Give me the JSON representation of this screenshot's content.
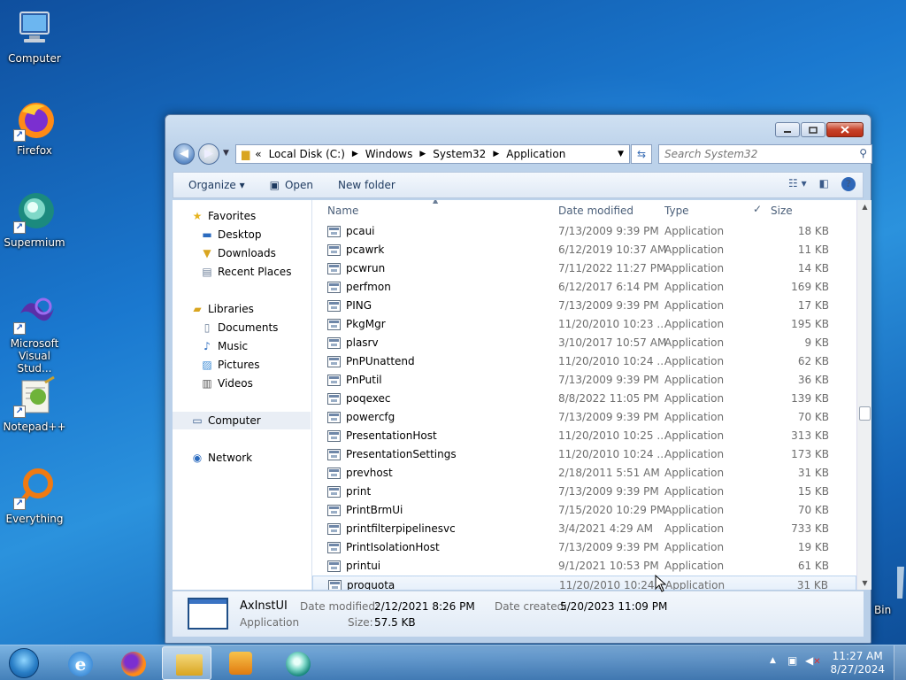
{
  "desktop": {
    "icons": [
      {
        "label": "Computer",
        "icon": "computer-icon"
      },
      {
        "label": "Firefox",
        "icon": "firefox-icon"
      },
      {
        "label": "Supermium",
        "icon": "supermium-icon"
      },
      {
        "label": "Microsoft Visual Stud...",
        "icon": "visual-studio-icon"
      },
      {
        "label": "Notepad++",
        "icon": "notepadpp-icon"
      },
      {
        "label": "Everything",
        "icon": "everything-icon"
      }
    ],
    "recycle_bin_label": "Bin"
  },
  "window": {
    "address": {
      "prefix": "«",
      "segments": [
        "Local Disk (C:)",
        "Windows",
        "System32",
        "Application"
      ]
    },
    "search_placeholder": "Search System32",
    "toolbar": {
      "organize": "Organize ▾",
      "open": "Open",
      "new_folder": "New folder"
    },
    "sidebar": {
      "favorites": "Favorites",
      "desktop": "Desktop",
      "downloads": "Downloads",
      "recent_places": "Recent Places",
      "libraries": "Libraries",
      "documents": "Documents",
      "music": "Music",
      "pictures": "Pictures",
      "videos": "Videos",
      "computer": "Computer",
      "network": "Network"
    },
    "columns": {
      "name": "Name",
      "date_modified": "Date modified",
      "type": "Type",
      "size": "Size"
    },
    "files": [
      {
        "name": "pcaui",
        "date": "7/13/2009 9:39 PM",
        "type": "Application",
        "size": "18 KB"
      },
      {
        "name": "pcawrk",
        "date": "6/12/2019 10:37 AM",
        "type": "Application",
        "size": "11 KB"
      },
      {
        "name": "pcwrun",
        "date": "7/11/2022 11:27 PM",
        "type": "Application",
        "size": "14 KB"
      },
      {
        "name": "perfmon",
        "date": "6/12/2017 6:14 PM",
        "type": "Application",
        "size": "169 KB"
      },
      {
        "name": "PING",
        "date": "7/13/2009 9:39 PM",
        "type": "Application",
        "size": "17 KB"
      },
      {
        "name": "PkgMgr",
        "date": "11/20/2010 10:23 ...",
        "type": "Application",
        "size": "195 KB"
      },
      {
        "name": "plasrv",
        "date": "3/10/2017 10:57 AM",
        "type": "Application",
        "size": "9 KB"
      },
      {
        "name": "PnPUnattend",
        "date": "11/20/2010 10:24 ...",
        "type": "Application",
        "size": "62 KB"
      },
      {
        "name": "PnPutil",
        "date": "7/13/2009 9:39 PM",
        "type": "Application",
        "size": "36 KB"
      },
      {
        "name": "poqexec",
        "date": "8/8/2022 11:05 PM",
        "type": "Application",
        "size": "139 KB"
      },
      {
        "name": "powercfg",
        "date": "7/13/2009 9:39 PM",
        "type": "Application",
        "size": "70 KB"
      },
      {
        "name": "PresentationHost",
        "date": "11/20/2010 10:25 ...",
        "type": "Application",
        "size": "313 KB"
      },
      {
        "name": "PresentationSettings",
        "date": "11/20/2010 10:24 ...",
        "type": "Application",
        "size": "173 KB"
      },
      {
        "name": "prevhost",
        "date": "2/18/2011 5:51 AM",
        "type": "Application",
        "size": "31 KB"
      },
      {
        "name": "print",
        "date": "7/13/2009 9:39 PM",
        "type": "Application",
        "size": "15 KB"
      },
      {
        "name": "PrintBrmUi",
        "date": "7/15/2020 10:29 PM",
        "type": "Application",
        "size": "70 KB"
      },
      {
        "name": "printfilterpipelinesvc",
        "date": "3/4/2021 4:29 AM",
        "type": "Application",
        "size": "733 KB"
      },
      {
        "name": "PrintIsolationHost",
        "date": "7/13/2009 9:39 PM",
        "type": "Application",
        "size": "19 KB"
      },
      {
        "name": "printui",
        "date": "9/1/2021 10:53 PM",
        "type": "Application",
        "size": "61 KB"
      },
      {
        "name": "proquota",
        "date": "11/20/2010 10:24 ...",
        "type": "Application",
        "size": "31 KB"
      }
    ],
    "details": {
      "name": "AxInstUI",
      "type": "Application",
      "date_modified_label": "Date modified:",
      "date_modified": "2/12/2021 8:26 PM",
      "date_created_label": "Date created:",
      "date_created": "5/20/2023 11:09 PM",
      "size_label": "Size:",
      "size": "57.5 KB"
    }
  },
  "taskbar": {
    "apps": [
      "internet-explorer-icon",
      "firefox-icon",
      "explorer-icon",
      "media-player-icon",
      "supermium-icon"
    ],
    "time": "11:27 AM",
    "date": "8/27/2024"
  }
}
